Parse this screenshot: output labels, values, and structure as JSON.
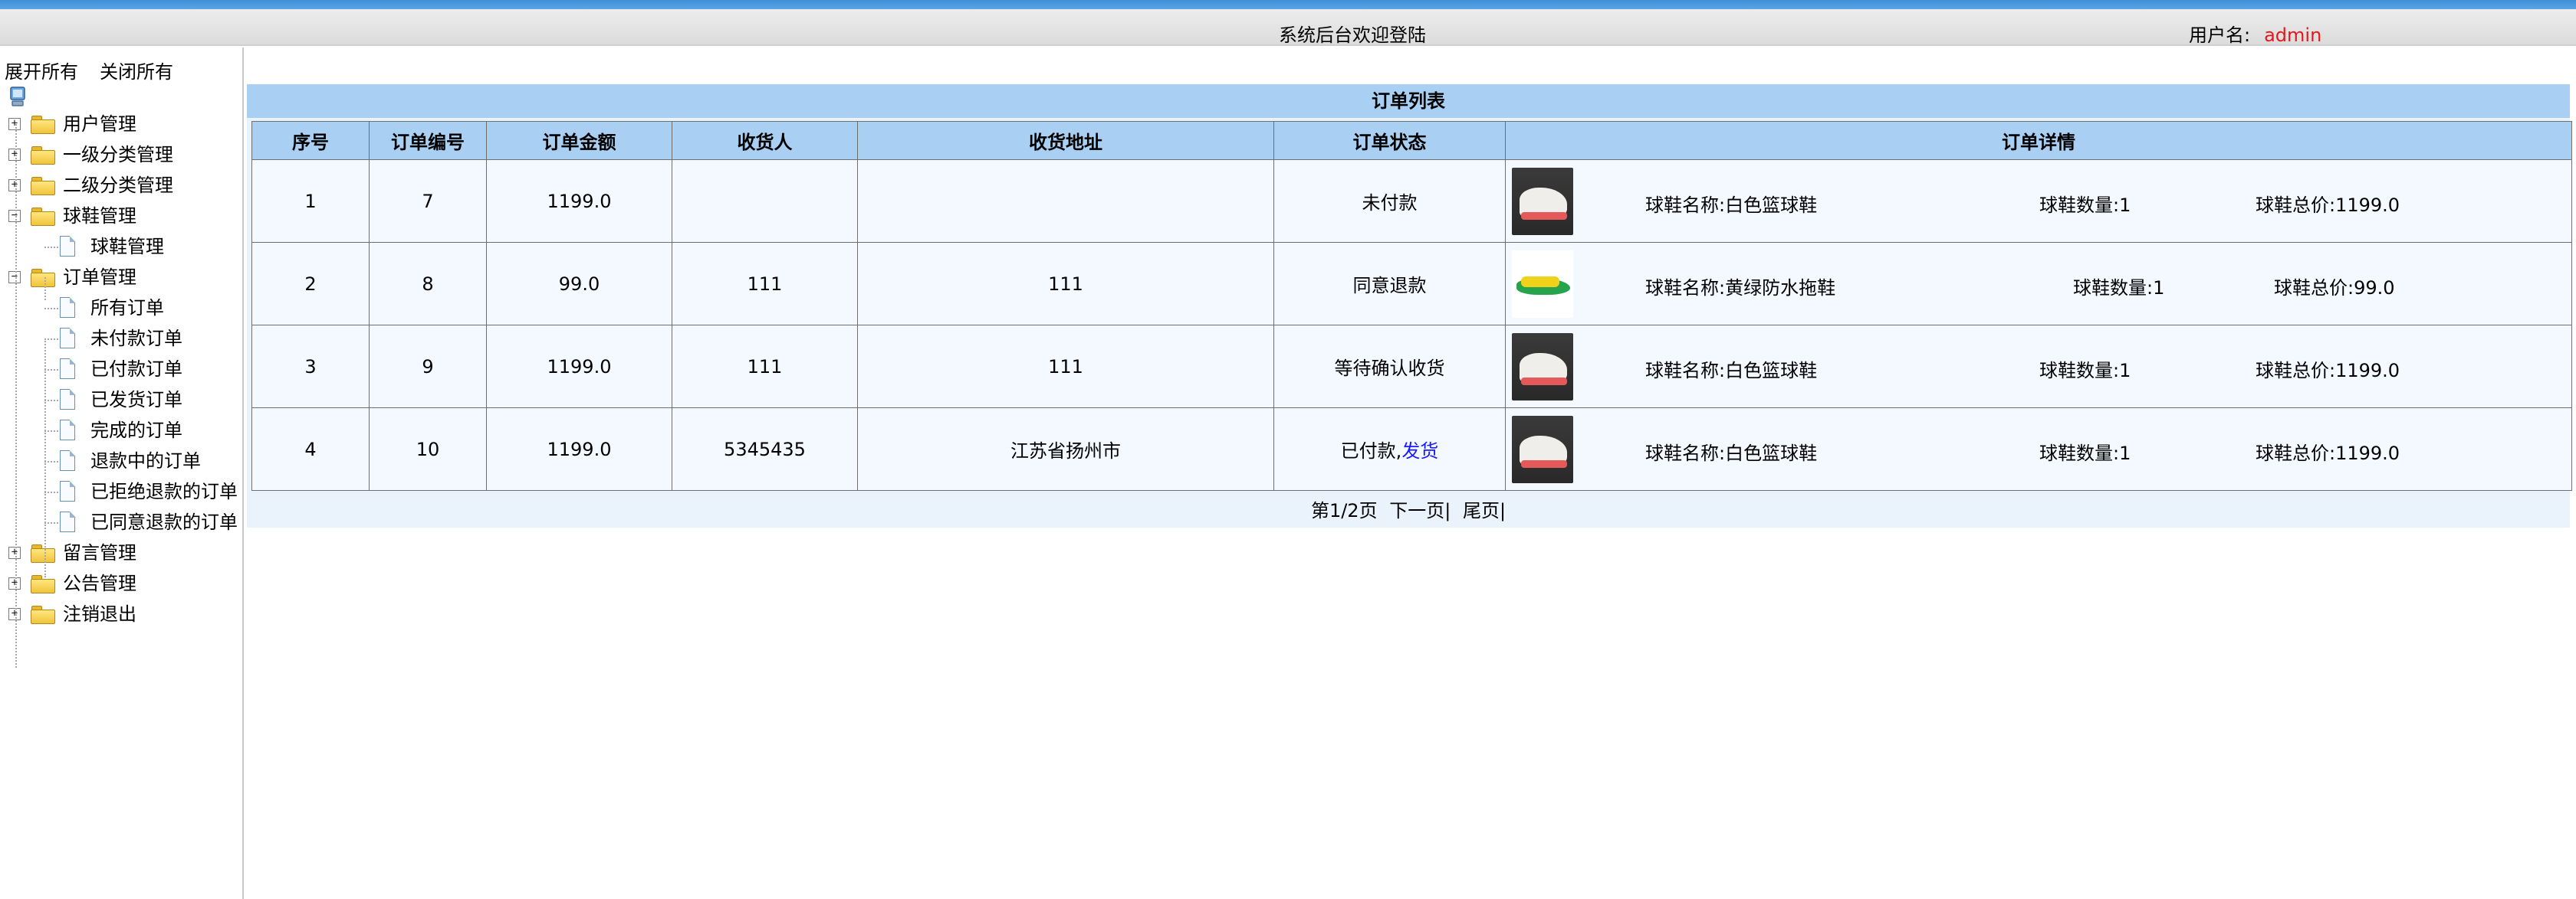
{
  "header": {
    "welcome": "系统后台欢迎登陆",
    "user_label": "用户名:",
    "username": "admin"
  },
  "sidebar": {
    "expand_all": "展开所有",
    "collapse_all": "关闭所有",
    "root_icon": "computer-icon",
    "items": [
      {
        "label": "用户管理",
        "type": "folder",
        "expanded": false
      },
      {
        "label": "一级分类管理",
        "type": "folder",
        "expanded": false
      },
      {
        "label": "二级分类管理",
        "type": "folder",
        "expanded": false
      },
      {
        "label": "球鞋管理",
        "type": "folder",
        "expanded": true
      },
      {
        "label": "球鞋管理",
        "type": "page"
      },
      {
        "label": "订单管理",
        "type": "folder",
        "expanded": true
      },
      {
        "label": "所有订单",
        "type": "page"
      },
      {
        "label": "未付款订单",
        "type": "page"
      },
      {
        "label": "已付款订单",
        "type": "page"
      },
      {
        "label": "已发货订单",
        "type": "page"
      },
      {
        "label": "完成的订单",
        "type": "page"
      },
      {
        "label": "退款中的订单",
        "type": "page"
      },
      {
        "label": "已拒绝退款的订单",
        "type": "page"
      },
      {
        "label": "已同意退款的订单",
        "type": "page"
      },
      {
        "label": "留言管理",
        "type": "folder",
        "expanded": false
      },
      {
        "label": "公告管理",
        "type": "folder",
        "expanded": false
      },
      {
        "label": "注销退出",
        "type": "folder",
        "expanded": false
      }
    ]
  },
  "main": {
    "title": "订单列表",
    "columns": [
      "序号",
      "订单编号",
      "订单金额",
      "收货人",
      "收货地址",
      "订单状态",
      "订单详情"
    ],
    "rows": [
      {
        "seq": "1",
        "order_no": "7",
        "amount": "1199.0",
        "receiver": "",
        "address": "",
        "status": "未付款",
        "action": "",
        "shoe_name": "球鞋名称:白色篮球鞋",
        "shoe_qty": "球鞋数量:1",
        "shoe_total": "球鞋总价:1199.0",
        "thumb": "white"
      },
      {
        "seq": "2",
        "order_no": "8",
        "amount": "99.0",
        "receiver": "111",
        "address": "111",
        "status": "同意退款",
        "action": "",
        "shoe_name": "球鞋名称:黄绿防水拖鞋",
        "shoe_qty": "球鞋数量:1",
        "shoe_total": "球鞋总价:99.0",
        "thumb": "yellow"
      },
      {
        "seq": "3",
        "order_no": "9",
        "amount": "1199.0",
        "receiver": "111",
        "address": "111",
        "status": "等待确认收货",
        "action": "",
        "shoe_name": "球鞋名称:白色篮球鞋",
        "shoe_qty": "球鞋数量:1",
        "shoe_total": "球鞋总价:1199.0",
        "thumb": "white"
      },
      {
        "seq": "4",
        "order_no": "10",
        "amount": "1199.0",
        "receiver": "5345435",
        "address": "江苏省扬州市",
        "status": "已付款,",
        "action": "发货",
        "shoe_name": "球鞋名称:白色篮球鞋",
        "shoe_qty": "球鞋数量:1",
        "shoe_total": "球鞋总价:1199.0",
        "thumb": "white"
      }
    ],
    "pager": {
      "page_info": "第1/2页",
      "next": "下一页|",
      "last": "尾页|"
    }
  }
}
